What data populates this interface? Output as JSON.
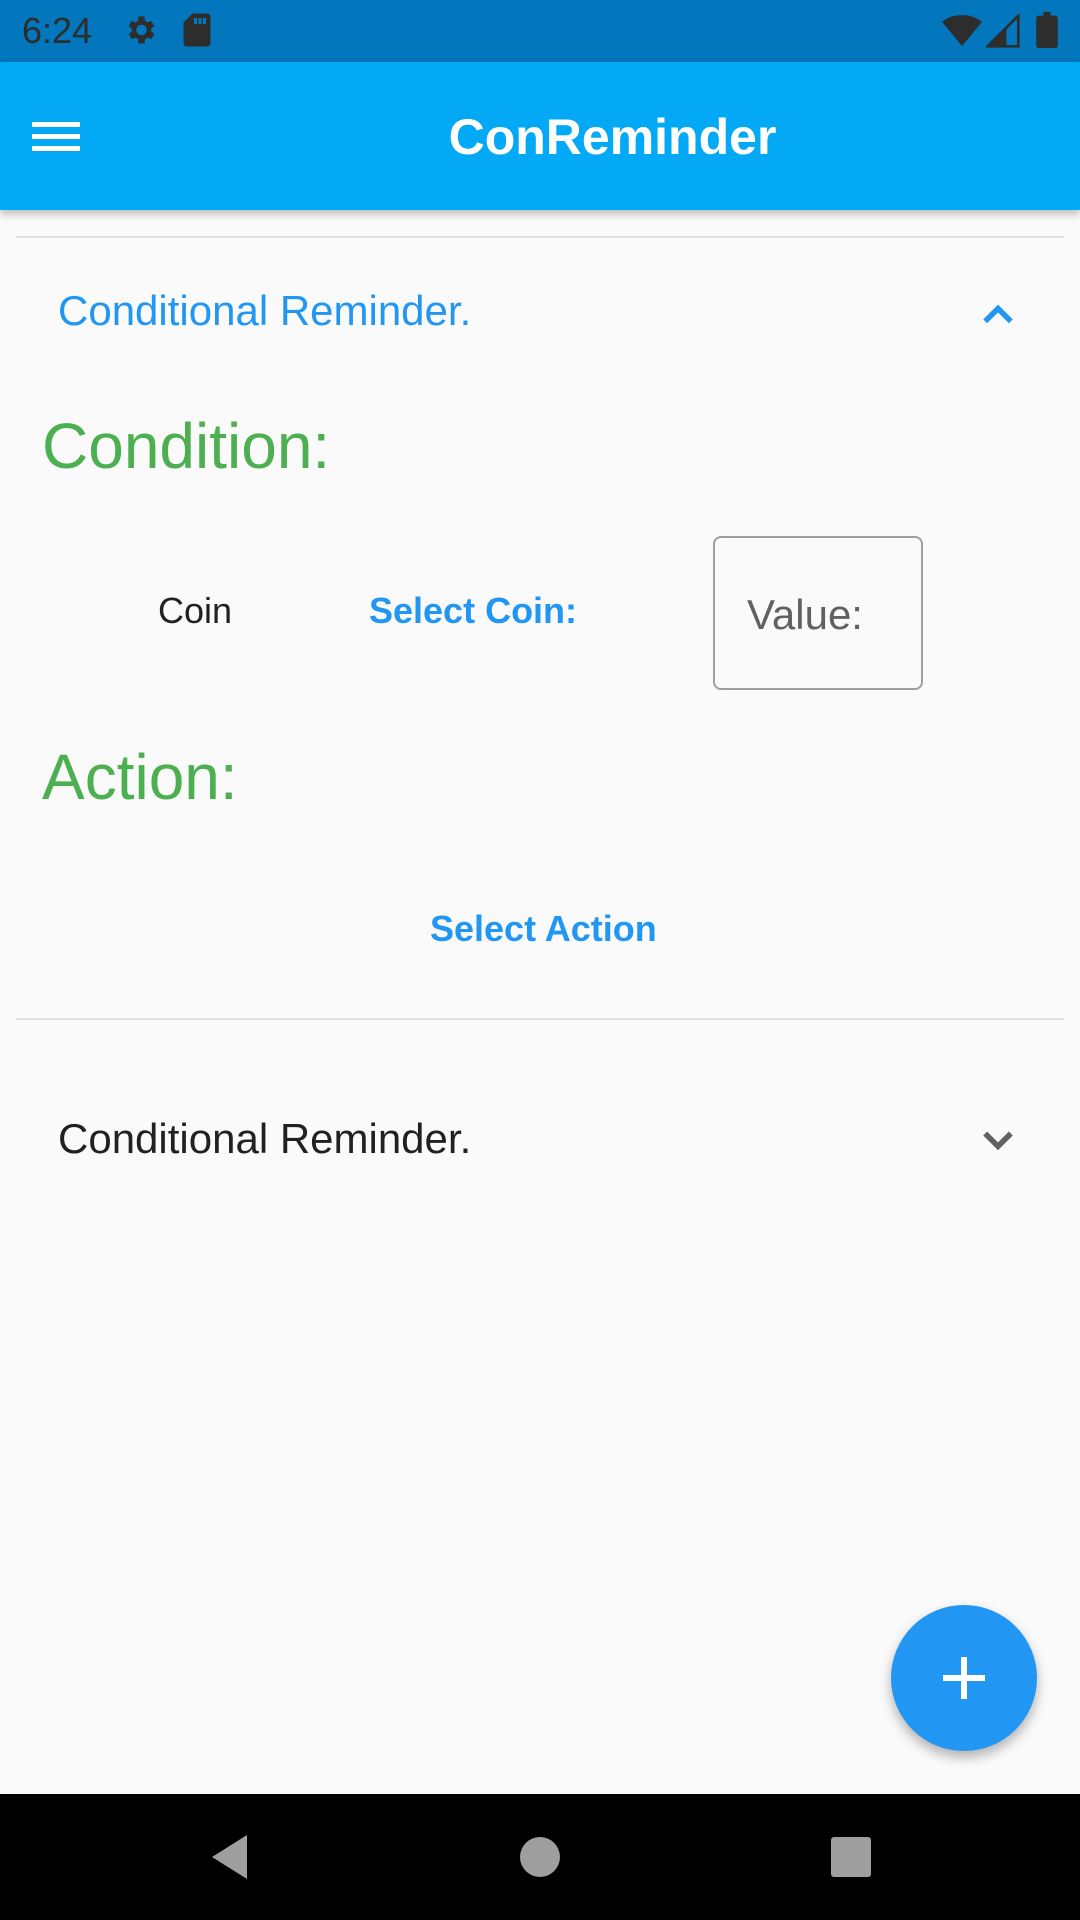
{
  "status_bar": {
    "time": "6:24",
    "icons": [
      "settings-icon",
      "sd-card-icon",
      "wifi-icon",
      "signal-icon",
      "battery-icon"
    ]
  },
  "app_bar": {
    "title": "ConReminder",
    "menu_icon": "hamburger-menu-icon"
  },
  "panels": [
    {
      "title": "Conditional Reminder.",
      "expanded": true,
      "condition": {
        "heading": "Condition:",
        "coin_label": "Coin",
        "select_coin_label": "Select Coin:",
        "value_placeholder": "Value:"
      },
      "action": {
        "heading": "Action:",
        "select_action_label": "Select Action"
      }
    },
    {
      "title": "Conditional Reminder.",
      "expanded": false
    }
  ],
  "fab": {
    "icon": "plus-icon"
  },
  "nav_bar": {
    "icons": [
      "back-icon",
      "home-icon",
      "recents-icon"
    ]
  },
  "colors": {
    "status_bar": "#0277bd",
    "app_bar": "#03a9f4",
    "accent": "#2196f3",
    "heading_green": "#4caf50",
    "background": "#fafafa"
  }
}
